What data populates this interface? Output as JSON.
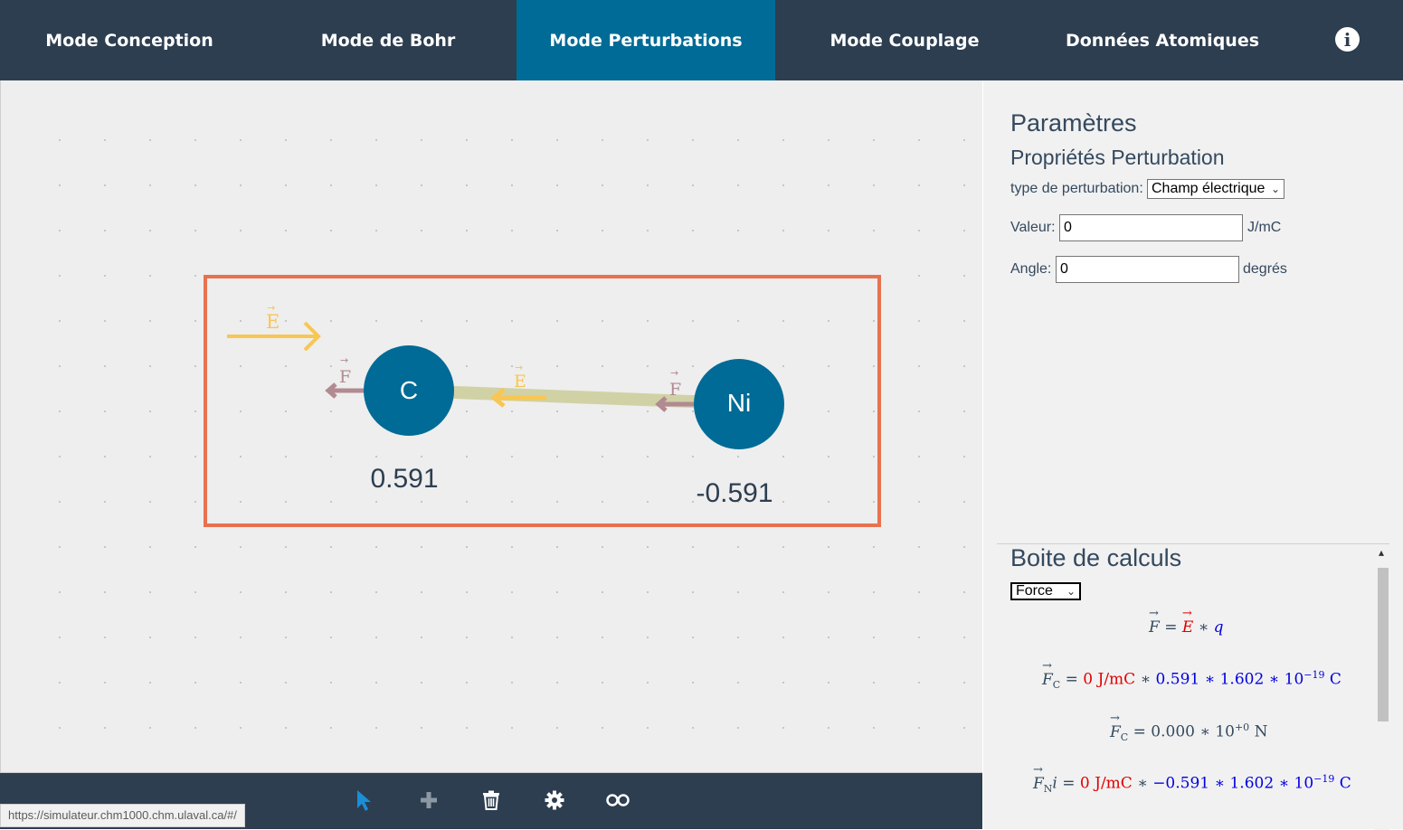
{
  "nav": {
    "tabs": [
      {
        "label": "Mode Conception",
        "active": false
      },
      {
        "label": "Mode de Bohr",
        "active": false
      },
      {
        "label": "Mode Perturbations",
        "active": true
      },
      {
        "label": "Mode Couplage",
        "active": false
      },
      {
        "label": "Données Atomiques",
        "active": false
      }
    ],
    "info_icon": "info-circle-icon"
  },
  "scene": {
    "field_label": "E",
    "force_label": "F",
    "atoms": [
      {
        "symbol": "C",
        "charge": "0.591"
      },
      {
        "symbol": "Ni",
        "charge": "-0.591"
      }
    ],
    "colors": {
      "atom": "#006b96",
      "bond": "#d0d2a6",
      "field_arrow": "#f8c653",
      "force_arrow": "#b28a92",
      "selection": "#e8724f"
    }
  },
  "toolbar": {
    "tools": [
      {
        "name": "select-tool",
        "icon": "cursor-icon",
        "active": true
      },
      {
        "name": "add-tool",
        "icon": "plus-icon",
        "active": false
      },
      {
        "name": "delete-tool",
        "icon": "trash-icon",
        "active": false
      },
      {
        "name": "settings-tool",
        "icon": "gear-icon",
        "active": false
      },
      {
        "name": "infinity-tool",
        "icon": "infinity-icon",
        "active": false
      }
    ]
  },
  "status_url": "https://simulateur.chm1000.chm.ulaval.ca/#/",
  "params": {
    "title": "Paramètres",
    "subtitle": "Propriétés Perturbation",
    "type_label": "type de perturbation:",
    "type_value": "Champ électrique",
    "valeur_label": "Valeur:",
    "valeur_value": "0",
    "valeur_unit": "J/mC",
    "angle_label": "Angle:",
    "angle_value": "0",
    "angle_unit": "degrés"
  },
  "calc": {
    "title": "Boite de calculs",
    "select_value": "Force",
    "eq1": {
      "lhs": "F",
      "eq": "=",
      "field": "E",
      "op": "∗",
      "q": "q"
    },
    "eq2": {
      "lhs": "F",
      "sub": "C",
      "eq": "=",
      "value": "0 J/mC",
      "op1": "∗",
      "charge": "0.591",
      "op2": "∗",
      "e": "1.602",
      "op3": "∗",
      "base": "10",
      "exp": "−19",
      "unit": "C"
    },
    "eq3": {
      "lhs": "F",
      "sub": "C",
      "eq": "=",
      "value": "0.000",
      "op": "∗",
      "base": "10",
      "exp": "+0",
      "unit": "N"
    },
    "eq4": {
      "lhs": "F",
      "sub": "N",
      "suffix": "i",
      "eq": "=",
      "value": "0 J/mC",
      "op1": "∗",
      "charge": "−0.591",
      "op2": "∗",
      "e": "1.602",
      "op3": "∗",
      "base": "10",
      "exp": "−19",
      "unit": "C"
    }
  }
}
